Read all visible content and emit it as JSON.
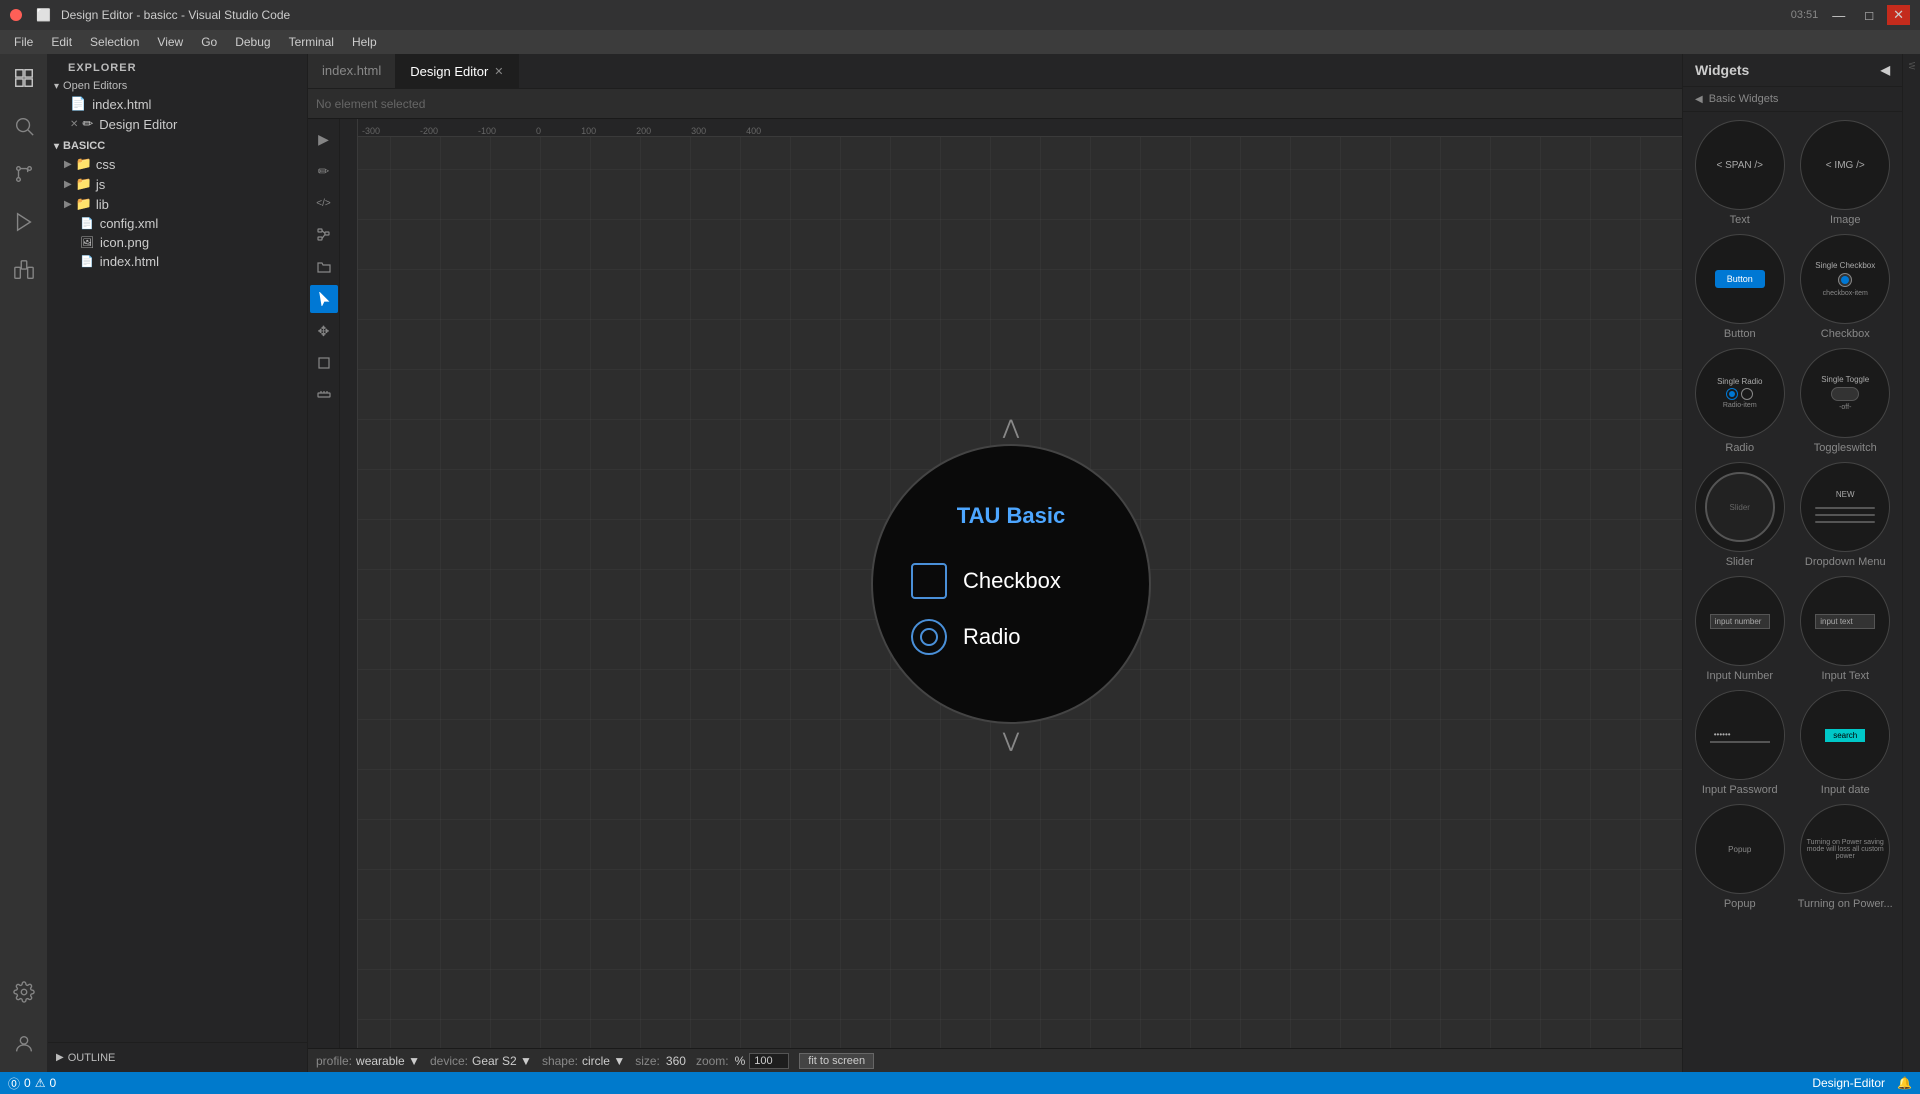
{
  "titlebar": {
    "title": "Design Editor - basicc - Visual Studio Code",
    "traffic_lights": [
      "red",
      "yellow",
      "green"
    ],
    "win_buttons": [
      "—",
      "□",
      "✕"
    ]
  },
  "menubar": {
    "items": [
      "File",
      "Edit",
      "Selection",
      "View",
      "Go",
      "Debug",
      "Terminal",
      "Help"
    ]
  },
  "activity_bar": {
    "items": [
      {
        "name": "explorer",
        "icon": "📁"
      },
      {
        "name": "search",
        "icon": "🔍"
      },
      {
        "name": "source-control",
        "icon": "⑂"
      },
      {
        "name": "run",
        "icon": "▶"
      },
      {
        "name": "extensions",
        "icon": "⬡"
      },
      {
        "name": "tau",
        "icon": "τ"
      },
      {
        "name": "design-editor",
        "icon": "✏"
      },
      {
        "name": "gear",
        "icon": "⚙"
      },
      {
        "name": "person",
        "icon": "👤"
      },
      {
        "name": "terminal-icon",
        "icon": "⬛"
      }
    ]
  },
  "sidebar": {
    "header": "Explorer",
    "sections": [
      {
        "name": "open_editors",
        "label": "Open Editors",
        "expanded": true,
        "items": [
          {
            "icon": "📄",
            "label": "index.html",
            "closable": false
          },
          {
            "icon": "✏",
            "label": "Design Editor",
            "closable": true
          }
        ]
      },
      {
        "name": "basicc",
        "label": "BASICC",
        "expanded": true,
        "folders": [
          {
            "label": "css",
            "expanded": false
          },
          {
            "label": "js",
            "expanded": false
          },
          {
            "label": "lib",
            "expanded": false
          }
        ],
        "files": [
          {
            "icon": "📄",
            "label": "config.xml"
          },
          {
            "icon": "🖼",
            "label": "icon.png"
          },
          {
            "icon": "📄",
            "label": "index.html"
          }
        ]
      }
    ],
    "outline": "OUTLINE"
  },
  "tabs": [
    {
      "label": "index.html",
      "active": false,
      "closable": false
    },
    {
      "label": "Design Editor",
      "active": true,
      "closable": true
    }
  ],
  "toolbar": {
    "no_element": "No element selected"
  },
  "left_tools": {
    "tools": [
      {
        "name": "play",
        "icon": "▶"
      },
      {
        "name": "edit",
        "icon": "✏"
      },
      {
        "name": "code",
        "icon": "</>"
      },
      {
        "name": "element-tree",
        "icon": "⌂"
      },
      {
        "name": "folder",
        "icon": "📁"
      },
      {
        "name": "cursor",
        "icon": "✏"
      },
      {
        "name": "move",
        "icon": "✥"
      },
      {
        "name": "eraser",
        "icon": "◻"
      },
      {
        "name": "grid",
        "icon": "⊞"
      }
    ]
  },
  "canvas": {
    "ruler_marks": [
      "-300",
      "-200",
      "-100",
      "0",
      "100",
      "200",
      "300",
      "400"
    ]
  },
  "device": {
    "title": "TAU Basic",
    "scroll_up": "⋀",
    "scroll_down": "⋁",
    "items": [
      {
        "type": "checkbox",
        "label": "Checkbox"
      },
      {
        "type": "radio",
        "label": "Radio"
      }
    ]
  },
  "bottom_toolbar": {
    "profile_label": "profile:",
    "profile_value": "wearable",
    "device_label": "device:",
    "device_value": "Gear S2",
    "shape_label": "shape:",
    "shape_value": "circle",
    "size_label": "size:",
    "size_value": "360",
    "zoom_label": "zoom:",
    "zoom_value": "100%",
    "fit_btn": "fit to screen"
  },
  "widgets_panel": {
    "header": "Widgets",
    "subheader": "Basic Widgets",
    "items": [
      {
        "name": "text-widget",
        "label": "Text",
        "preview_type": "text"
      },
      {
        "name": "image-widget",
        "label": "Image",
        "preview_type": "image"
      },
      {
        "name": "button-widget",
        "label": "Button",
        "preview_type": "button"
      },
      {
        "name": "checkbox-widget",
        "label": "Checkbox",
        "preview_type": "checkbox"
      },
      {
        "name": "radio-widget",
        "label": "Radio",
        "preview_type": "radio"
      },
      {
        "name": "toggleswitch-widget",
        "label": "Toggleswitch",
        "preview_type": "toggle"
      },
      {
        "name": "slider-widget",
        "label": "Slider",
        "preview_type": "slider"
      },
      {
        "name": "dropdown-widget",
        "label": "Dropdown Menu",
        "preview_type": "dropdown"
      },
      {
        "name": "input-number-widget",
        "label": "Input Number",
        "preview_type": "input_number"
      },
      {
        "name": "input-text-widget",
        "label": "Input Text",
        "preview_type": "input_text"
      },
      {
        "name": "input-password-widget",
        "label": "Input Password",
        "preview_type": "input_password"
      },
      {
        "name": "input-date-widget",
        "label": "Input date",
        "preview_type": "input_date"
      },
      {
        "name": "popup-widget",
        "label": "Popup",
        "preview_type": "popup"
      },
      {
        "name": "power-widget",
        "label": "Turning on Power saving mode will loss all custom power",
        "preview_type": "power"
      }
    ]
  },
  "status_bar": {
    "left_items": [
      "⓪ 0",
      "⚠ 0"
    ],
    "right_items": [
      "Design-Editor",
      "🔔"
    ]
  }
}
